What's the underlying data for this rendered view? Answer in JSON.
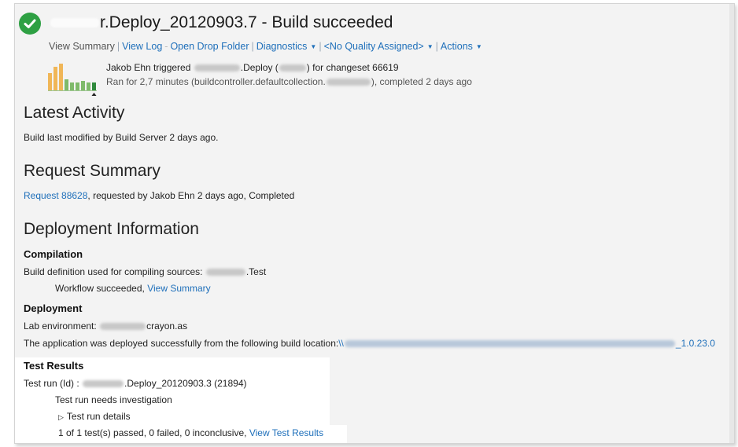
{
  "header": {
    "title_prefix_redacted": true,
    "title": "r.Deploy_20120903.7 - Build succeeded"
  },
  "menu": {
    "view_summary": "View Summary",
    "view_log": "View Log",
    "open_drop_folder": "Open Drop Folder",
    "diagnostics": "Diagnostics",
    "quality": "<No Quality Assigned>",
    "actions": "Actions"
  },
  "build_info": {
    "triggered_by": "Jakob Ehn triggered",
    "triggered_mid": ".Deploy (",
    "triggered_end": ") for changeset 66619",
    "ran_for_start": "Ran for 2,7 minutes (buildcontroller.defaultcollection.",
    "ran_for_end": "), completed 2 days ago",
    "sparkline": [
      22,
      30,
      34,
      14,
      10,
      10,
      12,
      10,
      10
    ],
    "spark_colors": {
      "success": "#7fba6b",
      "partial": "#f0b657",
      "current": "#2f8a3c"
    }
  },
  "latest_activity": {
    "heading": "Latest Activity",
    "text": "Build last modified by Build Server 2 days ago."
  },
  "request_summary": {
    "heading": "Request Summary",
    "request_link": "Request 88628",
    "request_text": ", requested by Jakob Ehn 2 days ago, Completed"
  },
  "deployment_information": {
    "heading": "Deployment Information",
    "compilation": {
      "heading": "Compilation",
      "build_def_text": "Build definition used for compiling sources:",
      "build_def_suffix": ".Test",
      "workflow_text": "Workflow succeeded,",
      "view_summary_link": "View Summary"
    },
    "deployment": {
      "heading": "Deployment",
      "lab_env_text": "Lab environment:",
      "lab_env_suffix": "crayon.as",
      "deployed_text": "The application was deployed successfully from the following build location:",
      "build_location_start": "\\\\",
      "build_location_end": "_1.0.23.0"
    }
  },
  "test_results": {
    "heading": "Test Results",
    "test_run_label": "Test run (Id) :",
    "test_run_value": ".Deploy_20120903.3 (21894)",
    "needs_investigation": "Test run needs investigation",
    "details_toggle": "Test run details",
    "summary_text": "1 of 1 test(s) passed, 0 failed, 0 inconclusive,",
    "view_test_results_link": "View Test Results"
  }
}
